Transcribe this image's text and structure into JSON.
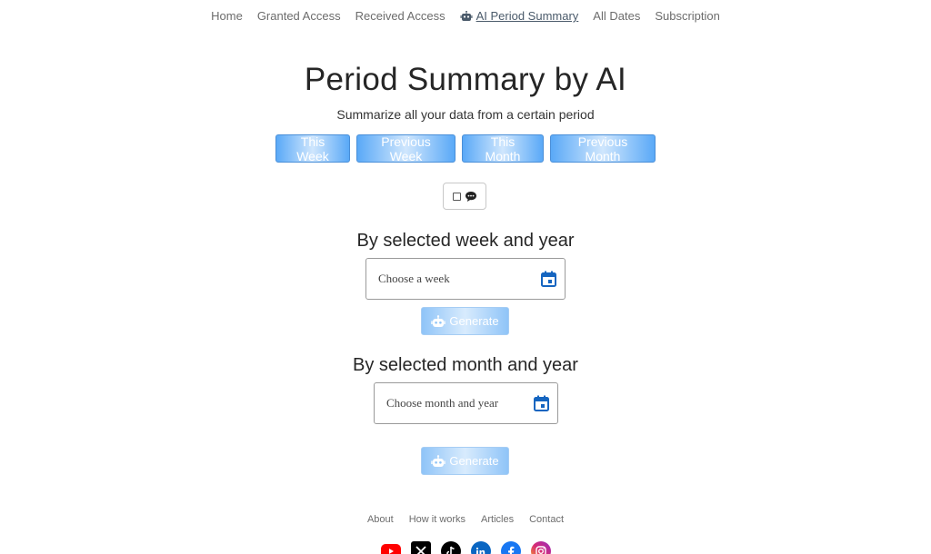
{
  "nav": {
    "items": [
      {
        "label": "Home"
      },
      {
        "label": "Granted Access"
      },
      {
        "label": "Received Access"
      },
      {
        "label": "AI Period Summary",
        "icon": "robot-icon",
        "active": true
      },
      {
        "label": "All Dates"
      },
      {
        "label": "Subscription"
      }
    ]
  },
  "main": {
    "title": "Period Summary by AI",
    "subtitle": "Summarize all your data from a certain period",
    "period_buttons": [
      "This Week",
      "Previous Week",
      "This Month",
      "Previous Month"
    ],
    "toggle": {
      "checked": false,
      "icon": "speech-bubble-icon"
    }
  },
  "week_section": {
    "heading": "By selected week and year",
    "input_placeholder": "Choose a week",
    "input_icon": "calendar-icon",
    "generate_label": "Generate",
    "generate_icon": "robot-icon"
  },
  "month_section": {
    "heading": "By selected month and year",
    "input_placeholder": "Choose month and year",
    "input_icon": "calendar-icon",
    "generate_label": "Generate",
    "generate_icon": "robot-icon"
  },
  "footer": {
    "links": [
      "About",
      "How it works",
      "Articles",
      "Contact"
    ],
    "socials": [
      {
        "name": "youtube-icon",
        "color": "#ff0000"
      },
      {
        "name": "x-icon",
        "color": "#000000"
      },
      {
        "name": "tiktok-icon",
        "color": "#000000"
      },
      {
        "name": "linkedin-icon",
        "color": "#0a66c2"
      },
      {
        "name": "facebook-icon",
        "color": "#1877f2"
      },
      {
        "name": "instagram-icon",
        "color": "#d62976"
      }
    ]
  },
  "colors": {
    "accent": "#5aa9f7",
    "calendar_icon": "#1565c0"
  }
}
